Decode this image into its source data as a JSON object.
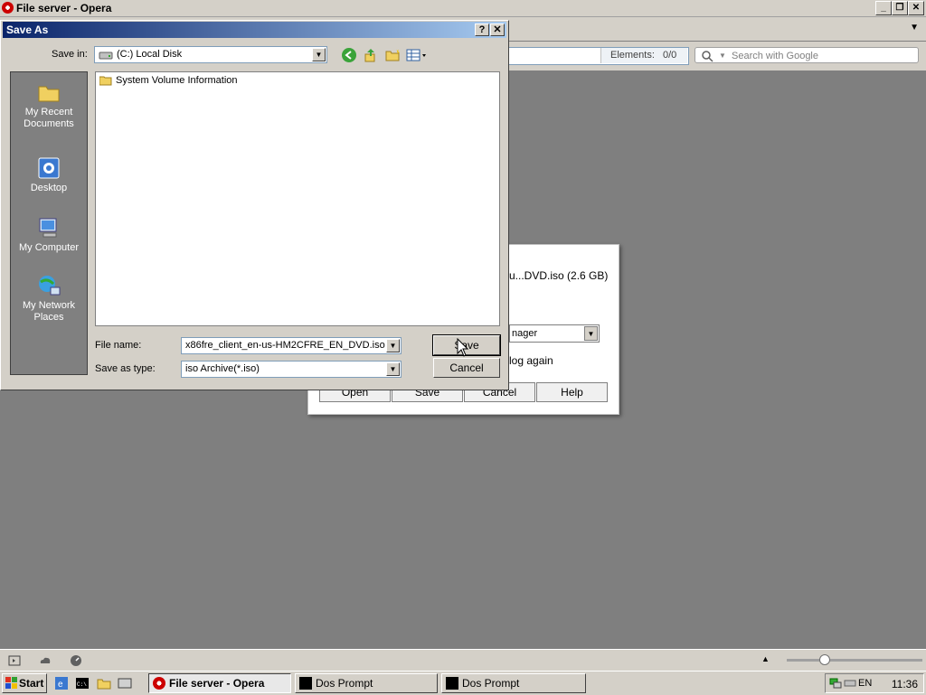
{
  "opera": {
    "window_title": "File server - Opera",
    "elements_label": "Elements:",
    "elements_value": "0/0",
    "search_placeholder": "Search with Google"
  },
  "download_dialog": {
    "filename_text": "u...DVD.iso (2.6 GB)",
    "handler_value": "nager",
    "ask_again_text": "log again",
    "buttons": [
      "Open",
      "Save",
      "Cancel",
      "Help"
    ]
  },
  "save_as": {
    "title": "Save As",
    "help_btn": "?",
    "close_btn": "✕",
    "save_in_label": "Save in:",
    "save_in_value": "(C:) Local Disk",
    "places": [
      {
        "label": "My Recent Documents",
        "icon": "folder-recent-icon"
      },
      {
        "label": "Desktop",
        "icon": "desktop-icon"
      },
      {
        "label": "My Computer",
        "icon": "my-computer-icon"
      },
      {
        "label": "My Network Places",
        "icon": "network-places-icon"
      }
    ],
    "files": [
      {
        "name": "System Volume Information",
        "icon": "folder-icon"
      }
    ],
    "file_name_label": "File name:",
    "file_name_value": "x86fre_client_en-us-HM2CFRE_EN_DVD.iso",
    "save_as_type_label": "Save as type:",
    "save_as_type_value": "iso Archive(*.iso)",
    "save_button": "Save",
    "cancel_button": "Cancel"
  },
  "taskbar": {
    "start_label": "Start",
    "tasks": [
      {
        "label": "File server - Opera",
        "active": true,
        "icon": "opera-icon"
      },
      {
        "label": "Dos Prompt",
        "active": false,
        "icon": "console-icon"
      },
      {
        "label": "Dos Prompt",
        "active": false,
        "icon": "console-icon"
      }
    ],
    "tray_lang": "EN",
    "clock": "11:36"
  },
  "colors": {
    "desktop_gray": "#7f7f7f",
    "dialog_title_start": "#0a246a",
    "dialog_title_end": "#a6caf0"
  }
}
